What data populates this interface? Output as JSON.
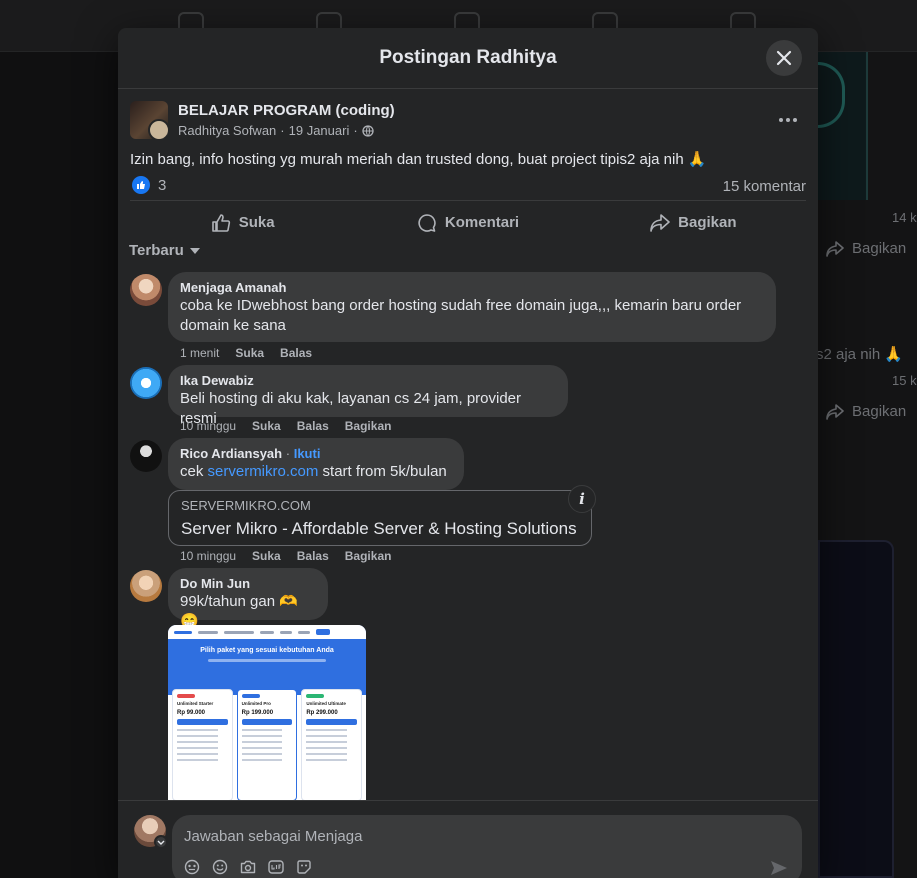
{
  "modal": {
    "title": "Postingan Radhitya"
  },
  "post": {
    "group_name": "BELAJAR PROGRAM (coding)",
    "author": "Radhitya Sofwan",
    "date": "19 Januari",
    "separator": "·",
    "text": "Izin bang, info hosting yg murah meriah dan trusted dong, buat project tipis2 aja nih 🙏",
    "like_count": "3",
    "comment_count": "15 komentar"
  },
  "actions": {
    "like": "Suka",
    "comment": "Komentari",
    "share": "Bagikan"
  },
  "sort_label": "Terbaru",
  "comments": [
    {
      "author": "Menjaga Amanah",
      "text_line1": "coba ke IDwebhost bang order hosting sudah free domain juga,,, kemarin baru order",
      "text_line2": "domain ke sana",
      "time": "1 menit",
      "like": "Suka",
      "reply": "Balas"
    },
    {
      "author": "Ika Dewabiz",
      "text": "Beli hosting di aku kak, layanan cs 24 jam, provider resmi",
      "time": "10 minggu",
      "like": "Suka",
      "reply": "Balas",
      "share": "Bagikan"
    },
    {
      "author": "Rico Ardiansyah",
      "follow": "Ikuti",
      "text_prefix": "cek ",
      "link": "servermikro.com",
      "text_suffix": " start from 5k/bulan",
      "time": "10 minggu",
      "like": "Suka",
      "reply": "Balas",
      "share": "Bagikan",
      "link_preview": {
        "domain": "SERVERMIKRO.COM",
        "title": "Server Mikro - Affordable Server & Hosting Solutions"
      }
    },
    {
      "author": "Do Min Jun",
      "text": "99k/tahun gan 🫶😁",
      "image": {
        "heading": "Pilih paket yang sesuai kebutuhan Anda",
        "plans": [
          {
            "name": "Unlimited Starter",
            "price": "Rp 99.000",
            "tag_color": "#e44b4b"
          },
          {
            "name": "Unlimited Pro",
            "price": "Rp 199.000",
            "tag_color": "#2f6fe0"
          },
          {
            "name": "Unlimited Ultimate",
            "price": "Rp 299.000",
            "tag_color": "#2bb673"
          }
        ]
      }
    }
  ],
  "composer": {
    "placeholder": "Jawaban sebagai Menjaga"
  },
  "background": {
    "count_1": "14 k",
    "share_1": "Bagikan",
    "snippet": "s2 aja nih 🙏",
    "count_2": "15 k",
    "share_2": "Bagikan"
  }
}
